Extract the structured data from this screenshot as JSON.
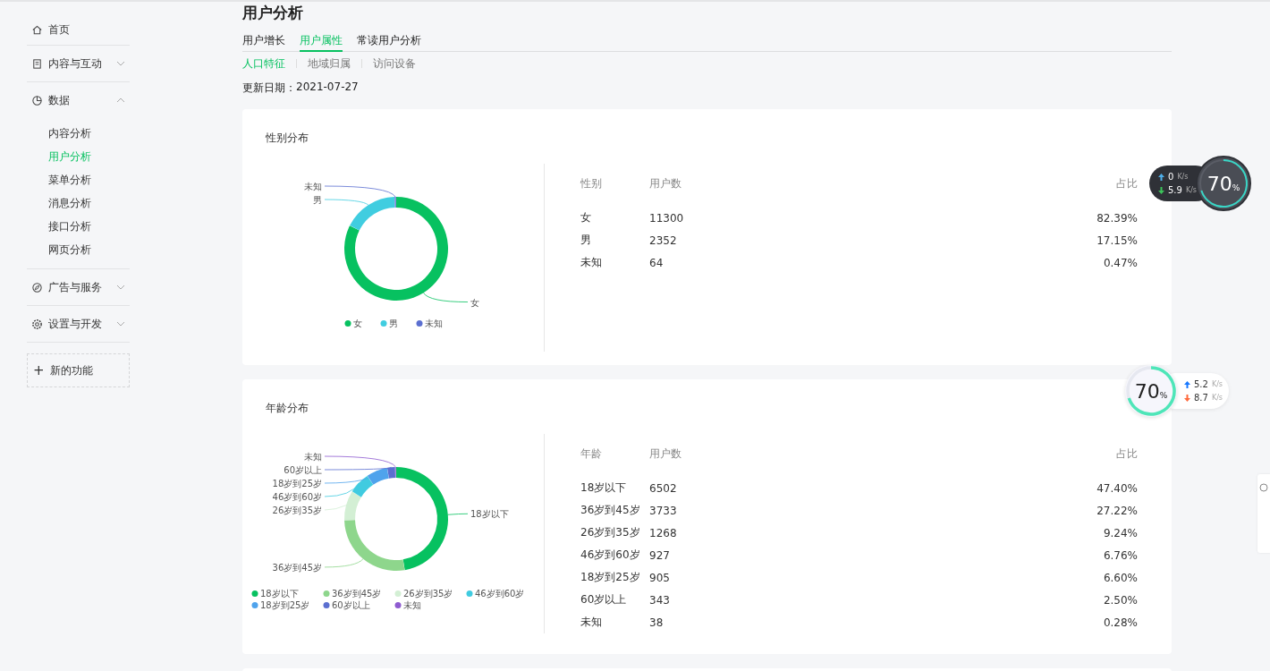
{
  "sidebar": {
    "items": [
      {
        "kind": "link",
        "label": "首页"
      },
      {
        "kind": "group",
        "label": "内容与互动",
        "expanded": false
      },
      {
        "kind": "group",
        "label": "数据",
        "expanded": true,
        "children": [
          {
            "label": "内容分析",
            "selected": false
          },
          {
            "label": "用户分析",
            "selected": true
          },
          {
            "label": "菜单分析",
            "selected": false
          },
          {
            "label": "消息分析",
            "selected": false
          },
          {
            "label": "接口分析",
            "selected": false
          },
          {
            "label": "网页分析",
            "selected": false
          }
        ]
      },
      {
        "kind": "group",
        "label": "广告与服务",
        "expanded": false
      },
      {
        "kind": "group",
        "label": "设置与开发",
        "expanded": false
      }
    ],
    "new_feature": {
      "icon_text": "+",
      "label": "新的功能"
    }
  },
  "page": {
    "title": "用户分析",
    "tabs": [
      {
        "label": "用户增长",
        "selected": false
      },
      {
        "label": "用户属性",
        "selected": true
      },
      {
        "label": "常读用户分析",
        "selected": false
      }
    ],
    "subtabs": [
      {
        "label": "人口特征",
        "selected": true
      },
      {
        "label": "地域归属",
        "selected": false
      },
      {
        "label": "访问设备",
        "selected": false
      }
    ],
    "update_label": "更新日期：",
    "update_date": "2021-07-27"
  },
  "cards": [
    {
      "title": "性别分布",
      "chart_data": {
        "type": "donut",
        "categories": [
          "女",
          "男",
          "未知"
        ],
        "values": [
          82.39,
          17.15,
          0.47
        ],
        "legend": "bottom",
        "colors": [
          "#07c160",
          "#40cde0",
          "#5b6fd0"
        ]
      },
      "table": {
        "columns": [
          "性别",
          "用户数",
          "占比"
        ],
        "rows": [
          [
            "女",
            "11300",
            "82.39%"
          ],
          [
            "男",
            "2352",
            "17.15%"
          ],
          [
            "未知",
            "64",
            "0.47%"
          ]
        ]
      }
    },
    {
      "title": "年龄分布",
      "chart_data": {
        "type": "donut",
        "categories": [
          "18岁以下",
          "36岁到45岁",
          "26岁到35岁",
          "46岁到60岁",
          "18岁到25岁",
          "60岁以上",
          "未知"
        ],
        "values": [
          47.4,
          27.22,
          9.24,
          6.76,
          6.6,
          2.5,
          0.28
        ],
        "legend": "bottom",
        "colors": [
          "#07c160",
          "#8ed68c",
          "#d3efd4",
          "#40cbe0",
          "#4fa3ec",
          "#5b6fd0",
          "#8e5bd0"
        ]
      },
      "table": {
        "columns": [
          "年龄",
          "用户数",
          "占比"
        ],
        "rows": [
          [
            "18岁以下",
            "6502",
            "47.40%"
          ],
          [
            "36岁到45岁",
            "3733",
            "27.22%"
          ],
          [
            "26岁到35岁",
            "1268",
            "9.24%"
          ],
          [
            "46岁到60岁",
            "927",
            "6.76%"
          ],
          [
            "18岁到25岁",
            "905",
            "6.60%"
          ],
          [
            "60岁以上",
            "343",
            "2.50%"
          ],
          [
            "未知",
            "38",
            "0.28%"
          ]
        ]
      }
    }
  ],
  "speed_widgets": [
    {
      "kind": "dark",
      "upload": "0",
      "upload_unit": "K/s",
      "download": "5.9",
      "download_unit": "K/s",
      "percent": "70",
      "percent_sign": "%"
    },
    {
      "kind": "light",
      "upload": "5.2",
      "upload_unit": "K/s",
      "download": "8.7",
      "download_unit": "K/s",
      "percent": "70",
      "percent_sign": "%"
    }
  ]
}
